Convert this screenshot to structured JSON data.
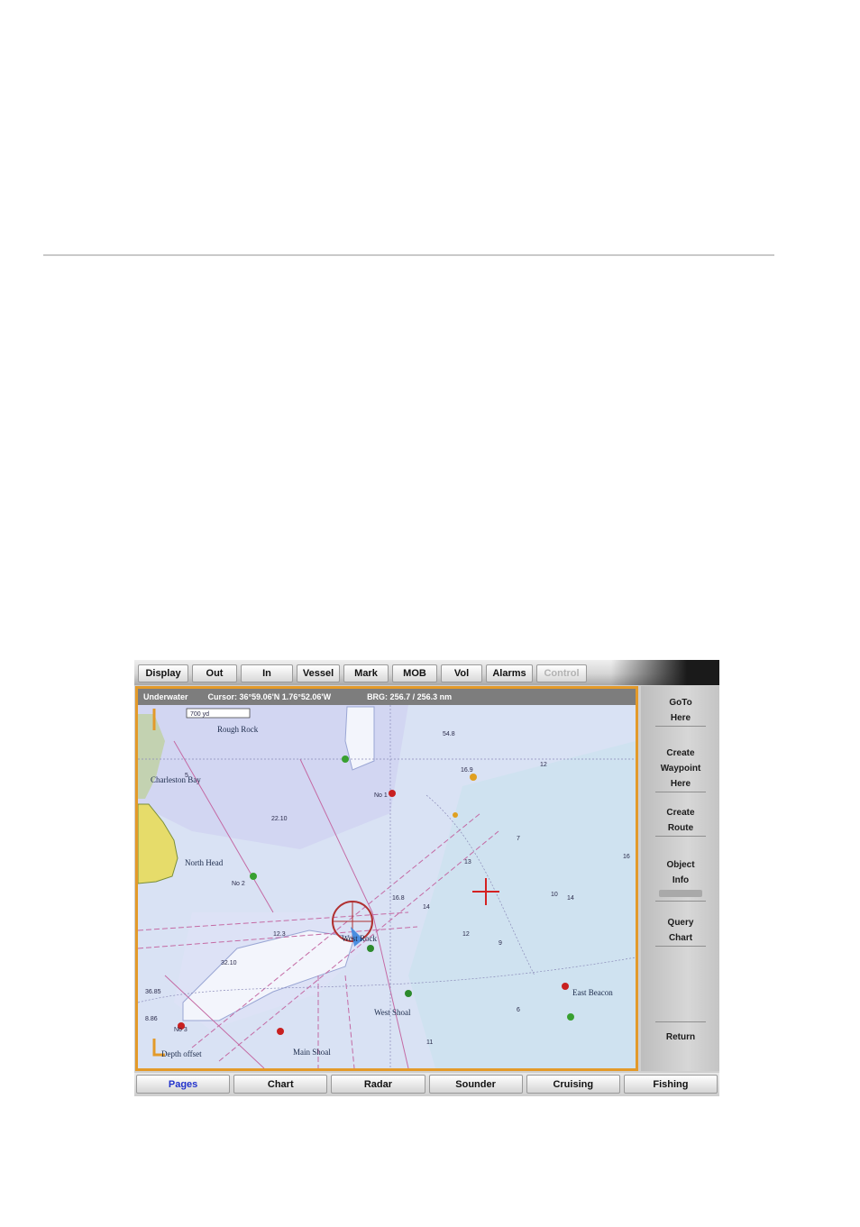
{
  "top_menu": {
    "items": [
      "Display",
      "Out",
      "In",
      "Vessel",
      "Mark",
      "MOB",
      "Vol",
      "Alarms",
      "Control"
    ]
  },
  "status_bar": {
    "mode": "Underwater",
    "position": "Cursor: 36°59.06'N 1.76°52.06'W",
    "bearing": "BRG: 256.7 / 256.3 nm"
  },
  "chart": {
    "scale": "700 yd",
    "labels": {
      "rough_rock": "Rough Rock",
      "charleston": "Charleston Bay",
      "north_head": "North Head",
      "depth_offset": "Depth offset",
      "west_rock": "West Rock",
      "west_shoal": "West Shoal",
      "main_shoal": "Main Shoal",
      "east_beacon": "East Beacon",
      "no_1": "No 1",
      "no_2": "No 2",
      "no_3": "No 3"
    },
    "depths": [
      "54.8",
      "16.9",
      "12",
      "5",
      "22.10",
      "16.8",
      "14",
      "12",
      "10",
      "36.85",
      "8.86",
      "12.3",
      "32.10",
      "7",
      "9",
      "6",
      "11",
      "13",
      "14",
      "16"
    ]
  },
  "side_keys": {
    "goto": [
      "GoTo",
      "Here"
    ],
    "create_waypoint": [
      "Create",
      "Waypoint",
      "Here"
    ],
    "create_route": [
      "Create",
      "Route"
    ],
    "object_info": [
      "Object",
      "Info"
    ],
    "query_chart": [
      "Query",
      "Chart"
    ],
    "return": "Return"
  },
  "bottom_menu": {
    "items": [
      "Pages",
      "Chart",
      "Radar",
      "Sounder",
      "Cruising",
      "Fishing"
    ]
  },
  "colors": {
    "frame_accent": "#e39a2a",
    "active_tab": "#2233cc",
    "land": "#e6dc6a",
    "deep_water": "#cfe2f0",
    "shallow_water": "#b9c8ec"
  }
}
